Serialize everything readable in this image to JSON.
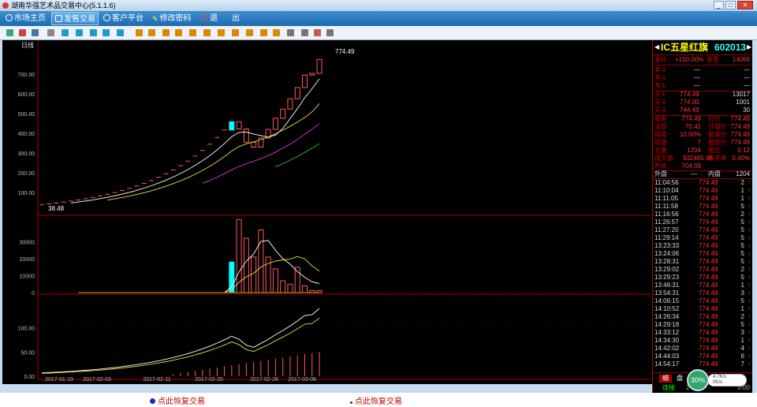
{
  "window": {
    "title": "湖南华强艺术品交易中心(5.1.1.6)"
  },
  "menu": [
    {
      "label": "市场主页",
      "icon": "globe-icon"
    },
    {
      "label": "发售交易",
      "icon": "hand-icon"
    },
    {
      "label": "客户平台",
      "icon": "globe-icon"
    },
    {
      "label": "修改密码",
      "icon": "key-icon"
    },
    {
      "label": "退",
      "icon": "power-icon"
    },
    {
      "label": "出",
      "icon": ""
    }
  ],
  "toolbar": {
    "button_count": 29
  },
  "colors": {
    "bg": "#000000",
    "price_line": "#ffffff",
    "ma_yellow": "#e0e040",
    "ma_magenta": "#e030e0",
    "ma_green": "#30c030",
    "candle_up": "#ff5a5a",
    "highlight": "#00ffff",
    "panel_text": "#ff3030"
  },
  "chart_data": {
    "type": "candlestick",
    "period_label": "日线",
    "last_label": "774.49",
    "first_label": "38.48",
    "ylim_price": [
      0,
      800
    ],
    "ylim_volume": [
      0,
      40000
    ],
    "ylim_amount": [
      0,
      150
    ],
    "price_ticks": [
      "700.00",
      "600.00",
      "500.00",
      "400.00",
      "300.00",
      "200.00",
      "100.00"
    ],
    "volume_ticks": [
      "30000",
      "20000",
      "10000",
      "0"
    ],
    "amount_ticks": [
      "100.00",
      "50.00",
      "0.00"
    ],
    "x_labels": [
      "2017-01-19",
      "2017-02-03",
      "2017-02-11",
      "2017-02-20",
      "2017-02-28",
      "2017-03-08"
    ],
    "series_count_days": 46,
    "close": [
      38.48,
      42.33,
      46.56,
      51.22,
      56.34,
      61.97,
      68.17,
      74.99,
      82.49,
      90.74,
      99.81,
      109.79,
      120.77,
      132.85,
      146.13,
      160.75,
      176.82,
      194.51,
      213.96,
      235.35,
      258.89,
      284.78,
      313.25,
      344.58,
      379.04,
      416.94,
      458.64,
      422.0,
      355.0,
      330.0,
      376.0,
      420.0,
      476.0,
      523.0,
      575.0,
      632.0,
      695.0,
      704.08,
      774.49
    ],
    "volume": [
      0,
      0,
      0,
      0,
      0,
      0,
      0,
      0,
      0,
      0,
      0,
      0,
      0,
      0,
      0,
      0,
      0,
      0,
      0,
      0,
      0,
      0,
      0,
      0,
      0,
      0,
      18000,
      43000,
      32000,
      21000,
      37000,
      21000,
      14000,
      7000,
      5000,
      15000,
      4000,
      1204,
      1204
    ]
  },
  "panel": {
    "title": "IC五星红旗",
    "code": "602013",
    "weibi": {
      "label": "委比",
      "value": "+100.00%",
      "label2": "委差",
      "value2": "14069"
    },
    "sell": [
      {
        "label": "卖③",
        "price": "—",
        "qty": "—"
      },
      {
        "label": "卖②",
        "price": "—",
        "qty": "—"
      },
      {
        "label": "卖①",
        "price": "—",
        "qty": "—"
      }
    ],
    "buy": [
      {
        "label": "买①",
        "price": "774.49",
        "qty": "13017"
      },
      {
        "label": "买②",
        "price": "774.00",
        "qty": "1001"
      },
      {
        "label": "买③",
        "price": "744.49",
        "qty": "30"
      }
    ],
    "stats": [
      {
        "l1": "最新",
        "v1": "774.49",
        "l2": "均价",
        "v2": "774.49"
      },
      {
        "l1": "涨跌",
        "v1": "70.41",
        "l2": "开盘价",
        "v2": "774.49"
      },
      {
        "l1": "幅度",
        "v1": "10.00%",
        "l2": "最高价",
        "v2": "774.49"
      },
      {
        "l1": "现量",
        "v1": "7",
        "l2": "最低价",
        "v2": "774.49"
      },
      {
        "l1": "总量",
        "v1": "1204",
        "l2": "量比",
        "v2": "0.12"
      },
      {
        "l1": "成交额",
        "v1": "932485.96",
        "l2": "换手率",
        "v2": "0.40%"
      },
      {
        "l1": "昨收",
        "v1": "704.08",
        "l2": "",
        "v2": ""
      }
    ],
    "waipan": {
      "label": "外盘",
      "value": "—",
      "label2": "内盘",
      "value2": "1204"
    },
    "ticks": [
      {
        "t": "11:04:56",
        "p": "774.49",
        "q": "2"
      },
      {
        "t": "11:10:04",
        "p": "774.49",
        "q": "1"
      },
      {
        "t": "11:11:05",
        "p": "774.49",
        "q": "1"
      },
      {
        "t": "11:11:58",
        "p": "774.49",
        "q": "5"
      },
      {
        "t": "11:16:56",
        "p": "774.49",
        "q": "2"
      },
      {
        "t": "11:26:57",
        "p": "774.49",
        "q": "5"
      },
      {
        "t": "11:27:20",
        "p": "774.49",
        "q": "5"
      },
      {
        "t": "11:29:14",
        "p": "774.49",
        "q": "5"
      },
      {
        "t": "13:23:33",
        "p": "774.49",
        "q": "5"
      },
      {
        "t": "13:24:06",
        "p": "774.49",
        "q": "5"
      },
      {
        "t": "13:28:31",
        "p": "774.49",
        "q": "5"
      },
      {
        "t": "13:29:02",
        "p": "774.49",
        "q": "2"
      },
      {
        "t": "13:29:23",
        "p": "774.49",
        "q": "5"
      },
      {
        "t": "13:46:31",
        "p": "774.49",
        "q": "1"
      },
      {
        "t": "13:54:31",
        "p": "774.49",
        "q": "3"
      },
      {
        "t": "14:06:15",
        "p": "774.49",
        "q": "5"
      },
      {
        "t": "14:10:52",
        "p": "774.49",
        "q": "1"
      },
      {
        "t": "14:26:34",
        "p": "774.49",
        "q": "2"
      },
      {
        "t": "14:29:18",
        "p": "774.49",
        "q": "5"
      },
      {
        "t": "14:33:12",
        "p": "774.49",
        "q": "3"
      },
      {
        "t": "14:34:30",
        "p": "774.49",
        "q": "1"
      },
      {
        "t": "14:42:02",
        "p": "774.49",
        "q": "4"
      },
      {
        "t": "14:44:03",
        "p": "774.49",
        "q": "6"
      },
      {
        "t": "14:54:17",
        "p": "774.49",
        "q": "7"
      }
    ],
    "bottom_tabs": [
      "细",
      "盘"
    ],
    "connect_label": "连接",
    "time_partial": "2",
    "time_partial2": "0:00"
  },
  "widget": {
    "percent": "30%",
    "up_label": "4.7K/s",
    "down_label": "0K/s"
  },
  "status": {
    "left": "点此恢复交易",
    "right": "点此恢复交易"
  }
}
